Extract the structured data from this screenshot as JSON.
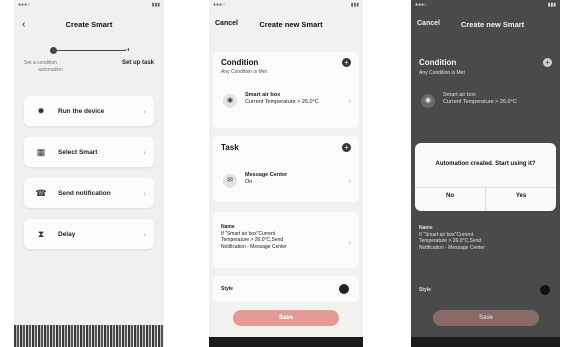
{
  "screen1": {
    "title": "Create Smart",
    "step1": "Set a condition",
    "step1_sub": "automation",
    "step2": "Set up task",
    "options": [
      {
        "label": "Run the device",
        "icon": "sun-icon"
      },
      {
        "label": "Select Smart",
        "icon": "smart-icon"
      },
      {
        "label": "Send notification",
        "icon": "bell-icon"
      },
      {
        "label": "Delay",
        "icon": "hourglass-icon"
      }
    ]
  },
  "screen2": {
    "cancel": "Cancel",
    "title": "Create new Smart",
    "condition": {
      "title": "Condition",
      "subtitle": "Any Condition is Met",
      "item_name": "Smart air box",
      "item_detail": "Current Temperature > 26.0°C"
    },
    "task": {
      "title": "Task",
      "item_name": "Message Center",
      "item_detail": "On"
    },
    "name": {
      "label": "Name",
      "lines": [
        "If \"Smart air box\"Current",
        "Temperature > 26.0°C,Send",
        "Notification - Message Center"
      ]
    },
    "style_label": "Style",
    "save": "Save"
  },
  "screen3": {
    "cancel": "Cancel",
    "title": "Create new Smart",
    "condition_title": "Condition",
    "condition_sub": "Any Condition is Met",
    "item_name": "Smart air box",
    "item_detail": "Current Temperature > 26.0°C",
    "dialog_message": "Automation created. Start using it?",
    "no": "No",
    "yes": "Yes",
    "name_label": "Name",
    "name_lines": [
      "If \"Smart air box\"Current",
      "Temperature > 26.0°C,Send",
      "Notification - Message Center"
    ],
    "style_label": "Style",
    "save": "Save"
  }
}
